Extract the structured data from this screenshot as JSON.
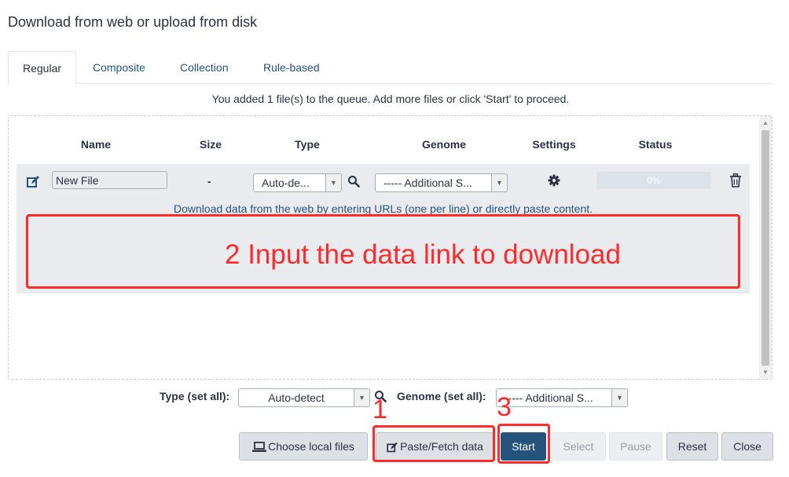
{
  "dialog": {
    "title": "Download from web or upload from disk"
  },
  "tabs": [
    {
      "label": "Regular",
      "active": true
    },
    {
      "label": "Composite"
    },
    {
      "label": "Collection"
    },
    {
      "label": "Rule-based"
    }
  ],
  "queue_message": "You added 1 file(s) to the queue. Add more files or click 'Start' to proceed.",
  "table": {
    "headers": [
      "Name",
      "Size",
      "Type",
      "Genome",
      "Settings",
      "Status"
    ],
    "row": {
      "name": "New File",
      "size": "-",
      "type": "Auto-de...",
      "genome": "----- Additional S...",
      "status": "0%",
      "progress": 0,
      "hint": "Download data from the web by entering URLs (one per line) or directly paste content."
    }
  },
  "set_all": {
    "type_label": "Type (set all):",
    "type_value": "Auto-detect",
    "genome_label": "Genome (set all):",
    "genome_value": "----- Additional S..."
  },
  "buttons": {
    "choose_local": "Choose local files",
    "paste_fetch": "Paste/Fetch data",
    "start": "Start",
    "select": "Select",
    "pause": "Pause",
    "reset": "Reset",
    "close": "Close"
  },
  "annotations": {
    "step1": "1",
    "step2": "2  Input the data link to download",
    "step3": "3"
  },
  "colors": {
    "annotation": "#ff2a2a",
    "primary": "#25537b"
  }
}
